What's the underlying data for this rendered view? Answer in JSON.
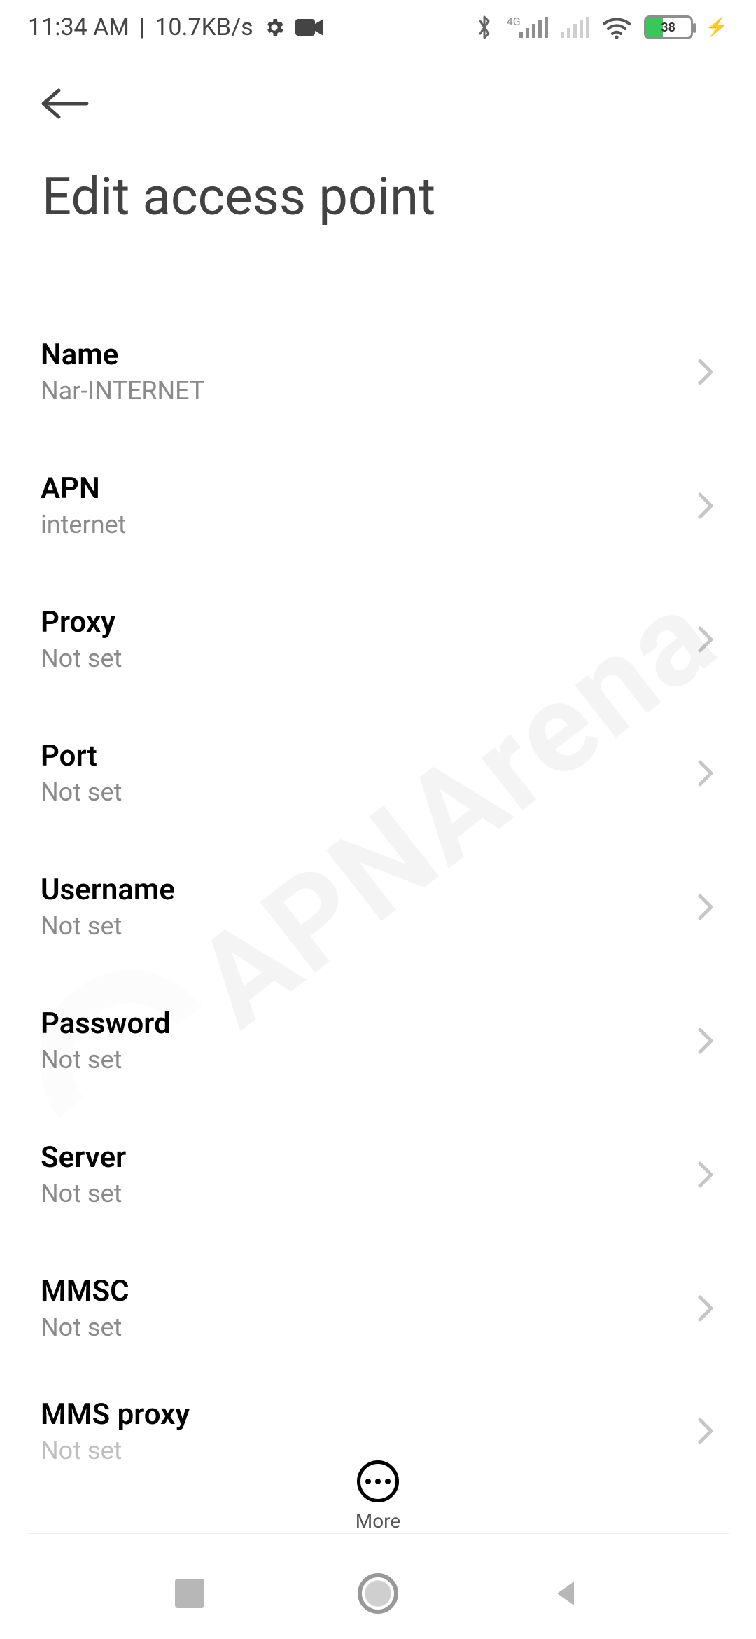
{
  "status": {
    "time": "11:34 AM",
    "speed": "10.7KB/s",
    "net_label": "4G",
    "battery_pct": "38"
  },
  "page": {
    "title": "Edit access point"
  },
  "rows": [
    {
      "label": "Name",
      "value": "Nar-INTERNET"
    },
    {
      "label": "APN",
      "value": "internet"
    },
    {
      "label": "Proxy",
      "value": "Not set"
    },
    {
      "label": "Port",
      "value": "Not set"
    },
    {
      "label": "Username",
      "value": "Not set"
    },
    {
      "label": "Password",
      "value": "Not set"
    },
    {
      "label": "Server",
      "value": "Not set"
    },
    {
      "label": "MMSC",
      "value": "Not set"
    },
    {
      "label": "MMS proxy",
      "value": "Not set"
    }
  ],
  "more": {
    "label": "More"
  },
  "watermark": "APNArena"
}
